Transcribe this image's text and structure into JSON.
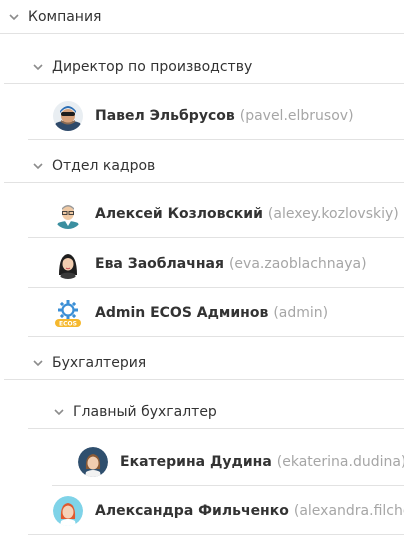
{
  "tree": {
    "root": {
      "label": "Компания"
    },
    "groups": {
      "director": {
        "label": "Директор по производству"
      },
      "hr": {
        "label": "Отдел кадров"
      },
      "accounting": {
        "label": "Бухгалтерия"
      },
      "chief_accountant": {
        "label": "Главный бухгалтер"
      }
    },
    "users": {
      "pavel": {
        "name": "Павел Эльбрусов",
        "login": "(pavel.elbrusov)",
        "avatar": "climber-avatar"
      },
      "alexey": {
        "name": "Алексей Козловский",
        "login": "(alexey.kozlovskiy)",
        "avatar": "man-glasses-avatar"
      },
      "eva": {
        "name": "Ева Заоблачная",
        "login": "(eva.zaoblachnaya)",
        "avatar": "woman-avatar"
      },
      "admin": {
        "name": "Admin ECOS Админов",
        "login": "(admin)",
        "avatar": "ecos-gear-avatar"
      },
      "ekaterina": {
        "name": "Екатерина Дудина",
        "login": "(ekaterina.dudina)",
        "avatar": "woman-round-avatar"
      },
      "alexandra": {
        "name": "Александра Фильченко",
        "login": "(alexandra.filche",
        "avatar": "red-hair-woman-avatar"
      }
    }
  },
  "colors": {
    "text": "#333333",
    "login": "#a6a6a6",
    "divider": "#e2e2e2",
    "chevron": "#8c8c8c"
  }
}
